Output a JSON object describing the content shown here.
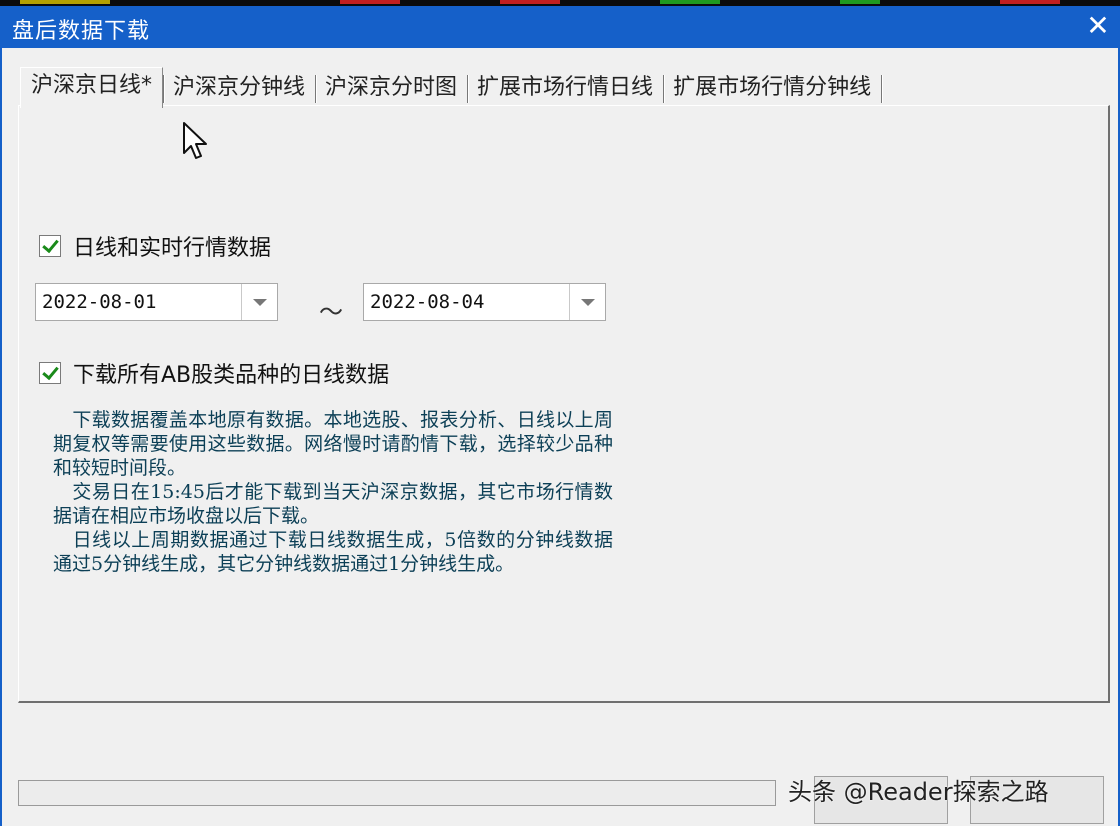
{
  "window": {
    "title": "盘后数据下载"
  },
  "tabs": [
    {
      "label": "沪深京日线*"
    },
    {
      "label": "沪深京分钟线"
    },
    {
      "label": "沪深京分时图"
    },
    {
      "label": "扩展市场行情日线"
    },
    {
      "label": "扩展市场行情分钟线"
    }
  ],
  "daily": {
    "checkbox_label": "日线和实时行情数据",
    "start_date": "2022-08-01",
    "separator": "～",
    "end_date": "2022-08-04",
    "ab_checkbox_label": "下载所有AB股类品种的日线数据",
    "notes": [
      "　下载数据覆盖本地原有数据。本地选股、报表分析、日线以上周期复权等需要使用这些数据。网络慢时请酌情下载，选择较少品种和较短时间段。",
      "　交易日在15:45后才能下载到当天沪深京数据，其它市场行情数据请在相应市场收盘以后下载。",
      "　日线以上周期数据通过下载日线数据生成，5倍数的分钟线数据通过5分钟线生成，其它分钟线数据通过1分钟线生成。"
    ]
  },
  "watermark": "头条 @Reader探索之路",
  "colors": {
    "titlebar": "#1560c9",
    "note_text": "#0c3f56",
    "check": "#1a8a1a"
  }
}
